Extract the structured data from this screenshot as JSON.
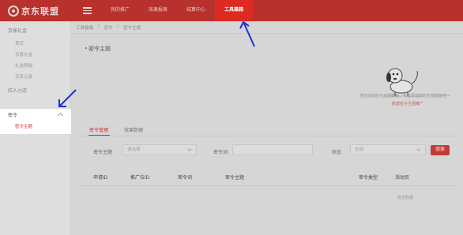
{
  "brand": {
    "name": "京东联盟"
  },
  "icons": {
    "menu": "hamburger-menu-icon",
    "collapse": "chevron-up-icon",
    "dropdown": "chevron-down-icon"
  },
  "colors": {
    "brand": "#b8312c",
    "accent": "#df2a22"
  },
  "nav": {
    "items": [
      {
        "label": "我的推广",
        "active": false
      },
      {
        "label": "效果报表",
        "active": false
      },
      {
        "label": "结算中心",
        "active": false
      },
      {
        "label": "工具箱箱",
        "active": true
      }
    ]
  },
  "sidebar": {
    "groups": [
      {
        "label": "京享礼金",
        "items": [
          "首页",
          "京喜礼金",
          "礼金明细",
          "京享记录"
        ]
      },
      {
        "label": "红人小店",
        "items": []
      },
      {
        "label": "密令",
        "items": [
          "密令主题"
        ]
      }
    ]
  },
  "breadcrumb": [
    "工具箱箱",
    "密令",
    "密令主题"
  ],
  "section": {
    "title": "密令主题"
  },
  "empty_state": {
    "message": "您还没有密令主题模板，先去添加您的主题模板吧～",
    "link": "新建密令主题推广"
  },
  "tabs": [
    "密令管理",
    "效果数据"
  ],
  "filters": {
    "theme": {
      "label": "密令主题",
      "value": "请选择"
    },
    "word": {
      "label": "密令词",
      "value": ""
    },
    "status": {
      "label": "状态",
      "value": "全部"
    },
    "search_label": "搜索"
  },
  "table": {
    "columns": [
      "申请ID",
      "推广位ID",
      "密令词",
      "密令主题",
      "密令类型",
      "活动页"
    ],
    "empty_text": "暂无数据"
  }
}
